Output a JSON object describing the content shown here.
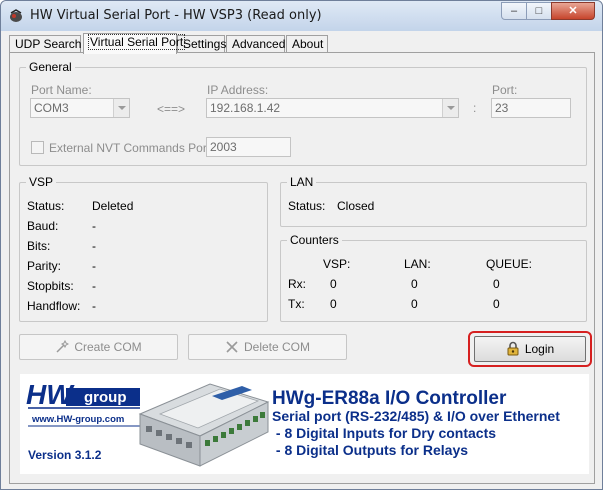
{
  "window": {
    "title": "HW Virtual Serial Port - HW VSP3 (Read only)",
    "controls": {
      "minimize": "–",
      "maximize": "□",
      "close": "✕"
    }
  },
  "tabs": [
    {
      "label": "UDP Search",
      "active": false
    },
    {
      "label": "Virtual Serial Port",
      "active": true
    },
    {
      "label": "Settings",
      "active": false
    },
    {
      "label": "Advanced",
      "active": false
    },
    {
      "label": "About",
      "active": false
    }
  ],
  "general": {
    "title": "General",
    "port_name_label": "Port Name:",
    "port_name_value": "COM3",
    "arrow_text": "<==>",
    "ip_label": "IP Address:",
    "ip_value": "192.168.1.42",
    "colon": ":",
    "port_label": "Port:",
    "port_value": "23",
    "nvt_label": "External NVT Commands Port:",
    "nvt_value": "2003"
  },
  "vsp": {
    "title": "VSP",
    "rows": [
      {
        "label": "Status:",
        "value": "Deleted"
      },
      {
        "label": "Baud:",
        "value": "-"
      },
      {
        "label": "Bits:",
        "value": "-"
      },
      {
        "label": "Parity:",
        "value": "-"
      },
      {
        "label": "Stopbits:",
        "value": "-"
      },
      {
        "label": "Handflow:",
        "value": "-"
      }
    ]
  },
  "lan": {
    "title": "LAN",
    "status_label": "Status:",
    "status_value": "Closed"
  },
  "counters": {
    "title": "Counters",
    "headers": [
      "VSP:",
      "LAN:",
      "QUEUE:"
    ],
    "rows": [
      {
        "label": "Rx:",
        "values": [
          "0",
          "0",
          "0"
        ]
      },
      {
        "label": "Tx:",
        "values": [
          "0",
          "0",
          "0"
        ]
      }
    ]
  },
  "buttons": {
    "create": "Create COM",
    "delete": "Delete COM",
    "login": "Login"
  },
  "banner": {
    "logo_hw": "HW",
    "logo_group": "group",
    "url": "www.HW-group.com",
    "version": "Version  3.1.2",
    "product_title": "HWg-ER88a  I/O Controller",
    "subtitle": "Serial port (RS-232/485) & I/O over Ethernet",
    "bullet1": " - 8 Digital Inputs for Dry contacts",
    "bullet2": " - 8 Digital Outputs for Relays",
    "brand_color": "#0b2f8a"
  }
}
